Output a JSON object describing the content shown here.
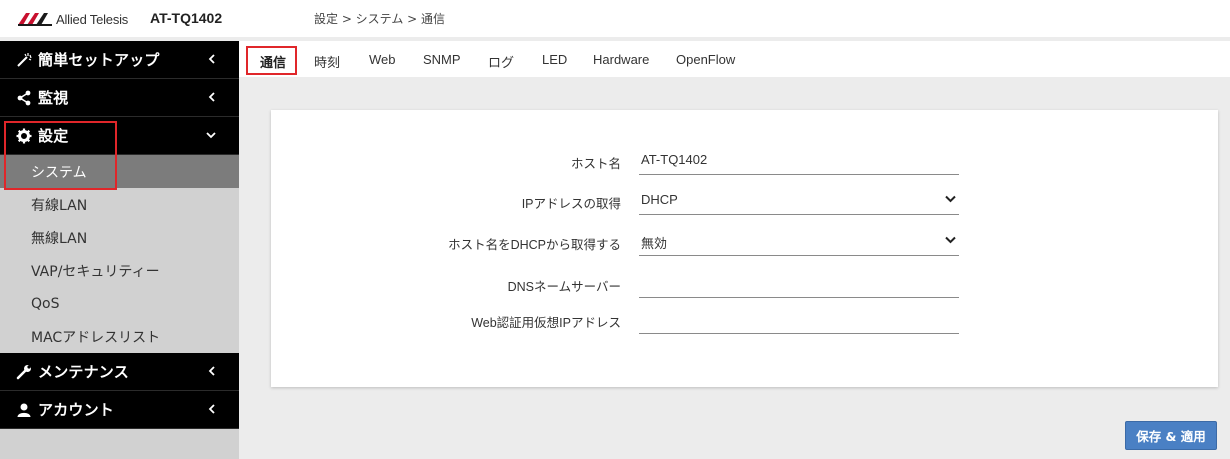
{
  "header": {
    "brand": "Allied Telesis",
    "model": "AT-TQ1402",
    "breadcrumb": "設定 > システム > 通信"
  },
  "sidebar": {
    "sections": [
      {
        "label": "簡単セットアップ",
        "icon": "magic-wand-icon",
        "chevron": "left"
      },
      {
        "label": "監視",
        "icon": "share-icon",
        "chevron": "left"
      },
      {
        "label": "設定",
        "icon": "gear-icon",
        "chevron": "down"
      },
      {
        "label": "メンテナンス",
        "icon": "wrench-icon",
        "chevron": "left"
      },
      {
        "label": "アカウント",
        "icon": "user-icon",
        "chevron": "left"
      }
    ],
    "settings_items": [
      {
        "label": "システム",
        "active": true
      },
      {
        "label": "有線LAN"
      },
      {
        "label": "無線LAN"
      },
      {
        "label": "VAP/セキュリティー"
      },
      {
        "label": "QoS"
      },
      {
        "label": "MACアドレスリスト"
      }
    ]
  },
  "tabs": [
    "通信",
    "時刻",
    "Web",
    "SNMP",
    "ログ",
    "LED",
    "Hardware",
    "OpenFlow"
  ],
  "active_tab": "通信",
  "form": {
    "hostname": {
      "label": "ホスト名",
      "value": "AT-TQ1402"
    },
    "ip_acquire": {
      "label": "IPアドレスの取得",
      "value": "DHCP"
    },
    "hostname_dhcp": {
      "label": "ホスト名をDHCPから取得する",
      "value": "無効"
    },
    "dns_server": {
      "label": "DNSネームサーバー",
      "value": ""
    },
    "web_auth_ip": {
      "label": "Web認証用仮想IPアドレス",
      "value": ""
    }
  },
  "save_button": "保存 & 適用",
  "colors": {
    "highlight": "#e0262a",
    "button": "#4a80c4",
    "sidebar_active": "#7c7c7c",
    "brand_red": "#c8102e"
  }
}
